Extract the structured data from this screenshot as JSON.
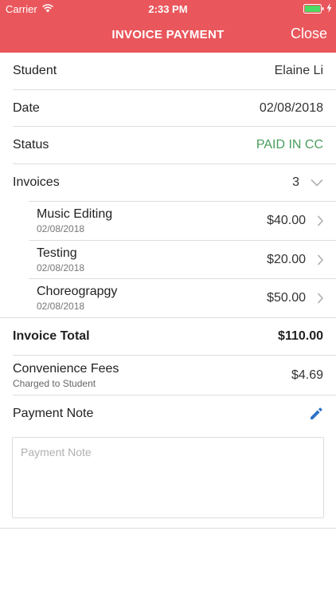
{
  "status_bar": {
    "carrier": "Carrier",
    "time": "2:33 PM"
  },
  "header": {
    "title": "INVOICE PAYMENT",
    "close_label": "Close",
    "background": "#e9575c"
  },
  "details": {
    "student_label": "Student",
    "student_value": "Elaine Li",
    "date_label": "Date",
    "date_value": "02/08/2018",
    "status_label": "Status",
    "status_value": "PAID IN CC",
    "status_color": "#4a9e5c",
    "invoices_label": "Invoices",
    "invoices_count": "3"
  },
  "invoices": [
    {
      "title": "Music Editing",
      "date": "02/08/2018",
      "amount": "$40.00"
    },
    {
      "title": "Testing",
      "date": "02/08/2018",
      "amount": "$20.00"
    },
    {
      "title": "Choreograpgy",
      "date": "02/08/2018",
      "amount": "$50.00"
    }
  ],
  "totals": {
    "invoice_total_label": "Invoice Total",
    "invoice_total_value": "$110.00",
    "fees_label": "Convenience Fees",
    "fees_sub": "Charged to Student",
    "fees_value": "$4.69"
  },
  "payment_note": {
    "label": "Payment Note",
    "placeholder": "Payment Note",
    "value": ""
  },
  "icons": {
    "edit": "pencil-icon",
    "expand": "chevron-down-icon",
    "open": "chevron-right-icon"
  }
}
